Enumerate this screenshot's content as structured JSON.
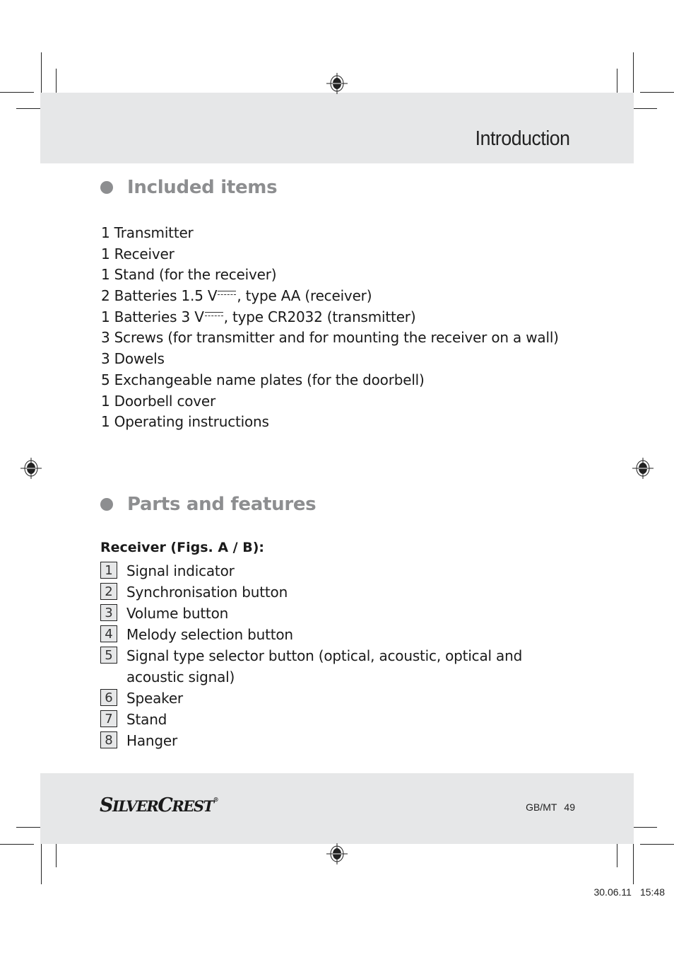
{
  "header": {
    "title": "Introduction"
  },
  "sections": {
    "included": {
      "title": "Included items",
      "items": [
        {
          "text": "1 Transmitter"
        },
        {
          "text": "1 Receiver"
        },
        {
          "text": "1 Stand (for the receiver)"
        },
        {
          "pre": "2 Batteries 1.5 V",
          "dc_symbol": true,
          "post": ", type AA (receiver)"
        },
        {
          "pre": "1 Batteries 3 V",
          "dc_symbol": true,
          "post": ", type CR2032 (transmitter)"
        },
        {
          "text": "3 Screws (for transmitter and for mounting the receiver on a wall)"
        },
        {
          "text": "3 Dowels"
        },
        {
          "text": "5 Exchangeable name plates (for the doorbell)"
        },
        {
          "text": "1 Doorbell cover"
        },
        {
          "text": "1 Operating instructions"
        }
      ]
    },
    "parts": {
      "title": "Parts and features",
      "subheading": "Receiver (Figs. A / B):",
      "items": [
        {
          "num": "1",
          "label": "Signal indicator"
        },
        {
          "num": "2",
          "label": "Synchronisation button"
        },
        {
          "num": "3",
          "label": "Volume button"
        },
        {
          "num": "4",
          "label": "Melody selection button"
        },
        {
          "num": "5",
          "label": "Signal type selector button (optical, acoustic, optical and acoustic signal)"
        },
        {
          "num": "6",
          "label": "Speaker"
        },
        {
          "num": "7",
          "label": "Stand"
        },
        {
          "num": "8",
          "label": "Hanger"
        }
      ]
    }
  },
  "footer": {
    "brand_first_initial": "S",
    "brand_first_rest": "ILVER",
    "brand_second_initial": "C",
    "brand_second_rest": "REST",
    "brand_mark": "®",
    "locale": "GB/MT",
    "page_number": "49"
  },
  "print_info": {
    "date": "30.06.11",
    "time": "15:48"
  },
  "icons": {
    "registration": "registration-mark-icon",
    "bullet": "bullet-dot-icon",
    "dc": "direct-current-symbol-icon"
  }
}
